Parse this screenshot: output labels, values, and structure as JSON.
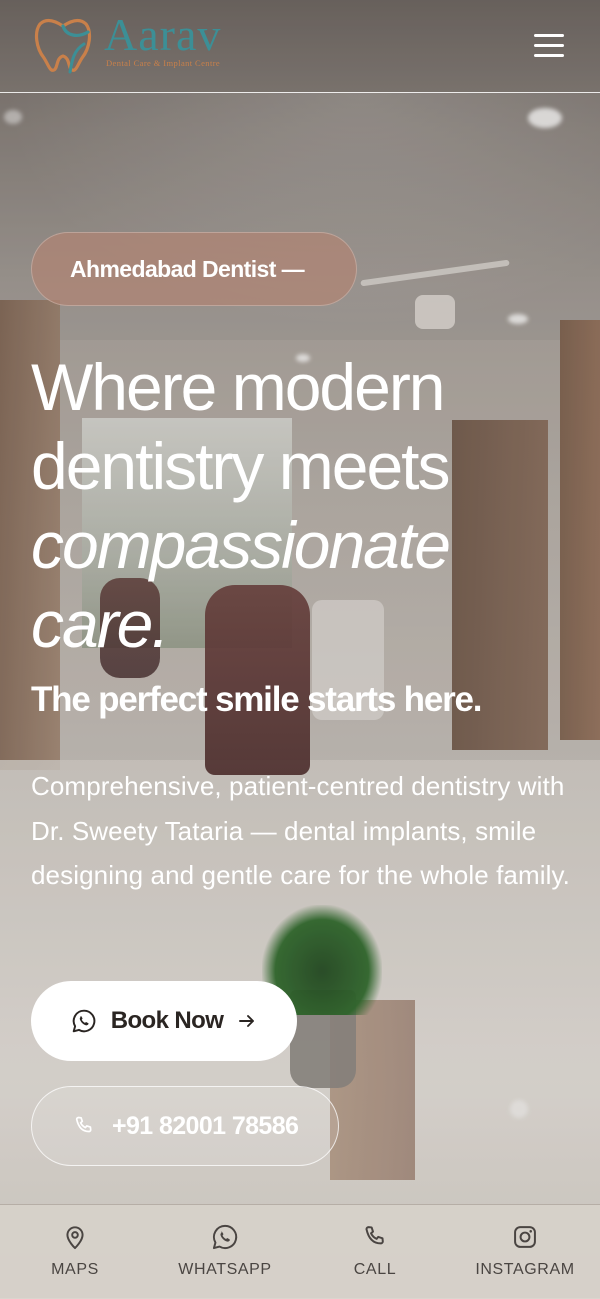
{
  "brand": {
    "name": "Aarav",
    "tagline": "Dental Care & Implant Centre",
    "logo_colors": {
      "teal": "#3c8f96",
      "copper": "#c9804a"
    }
  },
  "header": {
    "menu_icon": "hamburger-menu-icon"
  },
  "hero": {
    "eyebrow": "Ahmedabad Dentist —",
    "headline_line1": "Where modern",
    "headline_line2": "dentistry meets",
    "headline_em1": "compassionate",
    "headline_em2": "care.",
    "subhead": "The perfect smile starts here.",
    "description": "Comprehensive, patient-centred dentistry with Dr. Sweety Tataria — dental implants, smile designing and gentle care for the whole family."
  },
  "cta": {
    "book_label": "Book Now",
    "book_icon": "whatsapp-icon",
    "phone_label": "+91 82001 78586",
    "phone_icon": "phone-icon"
  },
  "bottom_nav": {
    "items": [
      {
        "label": "MAPS",
        "icon": "map-pin-icon"
      },
      {
        "label": "WHATSAPP",
        "icon": "whatsapp-icon"
      },
      {
        "label": "CALL",
        "icon": "phone-icon"
      },
      {
        "label": "INSTAGRAM",
        "icon": "instagram-icon"
      }
    ]
  },
  "colors": {
    "pill_bg": "#b08473",
    "nav_bg": "#d7d1ca",
    "nav_text": "#4a4542"
  }
}
